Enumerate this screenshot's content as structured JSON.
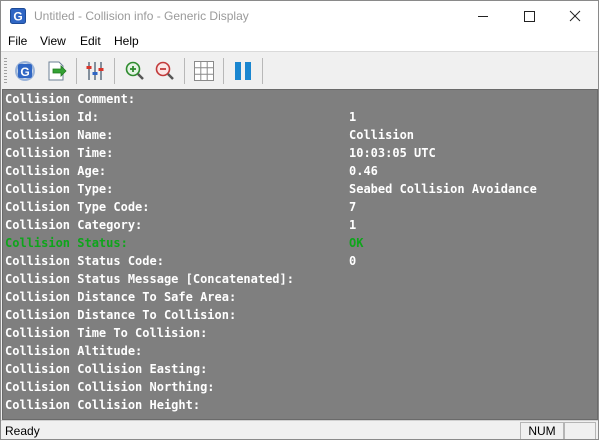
{
  "window": {
    "title": "Untitled - Collision info - Generic Display"
  },
  "menu": [
    "File",
    "View",
    "Edit",
    "Help"
  ],
  "toolbar": {
    "icons": [
      "app-logo-icon",
      "export-icon",
      "mixer-icon",
      "zoom-in-icon",
      "zoom-out-icon",
      "grid-icon",
      "pause-icon"
    ]
  },
  "rows": [
    {
      "label": "Collision Comment:",
      "value": ""
    },
    {
      "label": "Collision Id:",
      "value": "1"
    },
    {
      "label": "Collision Name:",
      "value": "Collision"
    },
    {
      "label": "Collision Time:",
      "value": "10:03:05 UTC"
    },
    {
      "label": "Collision Age:",
      "value": "0.46"
    },
    {
      "label": "Collision Type:",
      "value": "Seabed Collision Avoidance"
    },
    {
      "label": "Collision Type Code:",
      "value": "7"
    },
    {
      "label": "Collision Category:",
      "value": "1"
    },
    {
      "label": "Collision Status:",
      "value": "OK"
    },
    {
      "label": "Collision Status Code:",
      "value": "0"
    },
    {
      "label": "Collision Status Message [Concatenated]:",
      "value": ""
    },
    {
      "label": "Collision Distance To Safe Area:",
      "value": ""
    },
    {
      "label": "Collision Distance To Collision:",
      "value": ""
    },
    {
      "label": "Collision Time To Collision:",
      "value": ""
    },
    {
      "label": "Collision Altitude:",
      "value": ""
    },
    {
      "label": "Collision Collision Easting:",
      "value": ""
    },
    {
      "label": "Collision Collision Northing:",
      "value": ""
    },
    {
      "label": "Collision Collision Height:",
      "value": ""
    }
  ],
  "status": {
    "text": "Ready",
    "num": "NUM"
  },
  "colors": {
    "content_bg": "#7f7f7f",
    "text": "#ffffff",
    "ok": "#0ea51b"
  }
}
